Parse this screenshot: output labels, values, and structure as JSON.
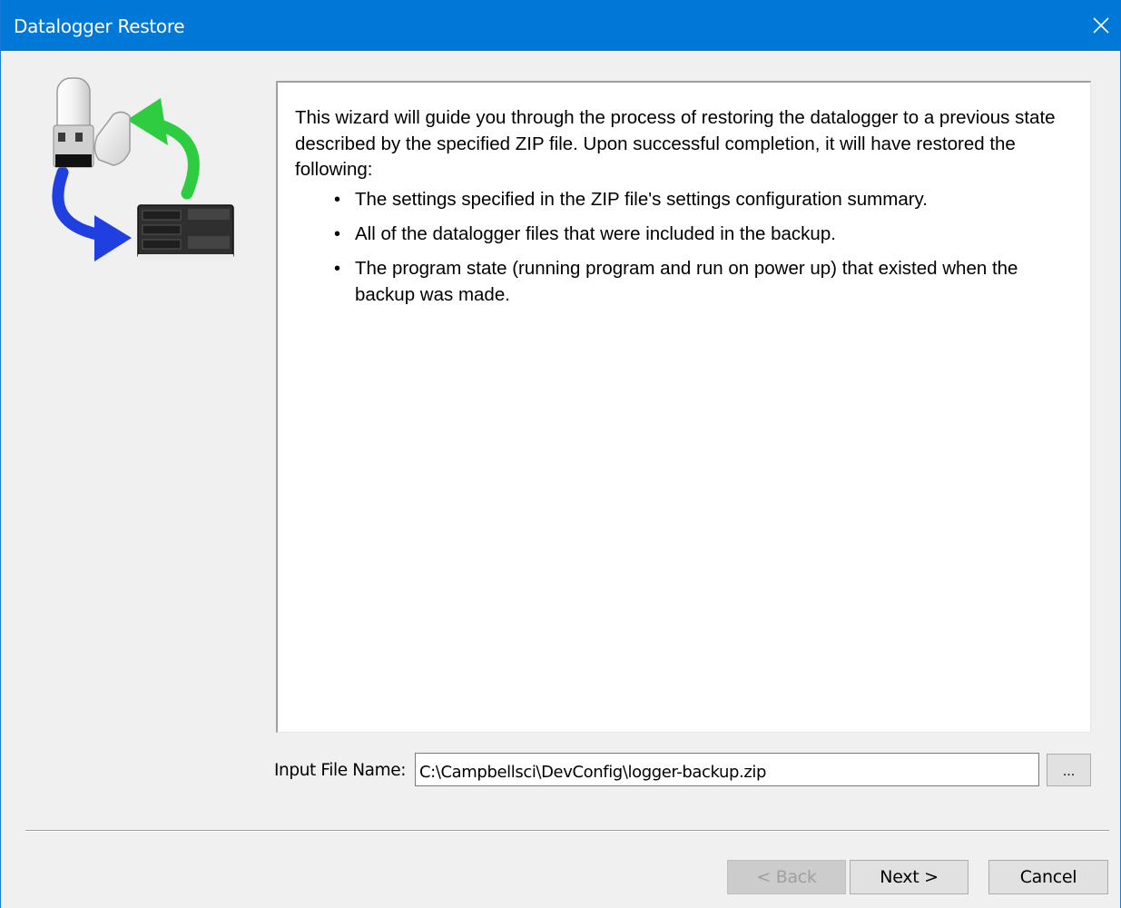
{
  "window": {
    "title": "Datalogger Restore"
  },
  "description": {
    "intro": "This wizard will guide you through the process of restoring the datalogger to a previous state described by the specified ZIP file. Upon successful completion, it will have restored the following:",
    "items": [
      "The settings specified in the ZIP file's settings configuration summary.",
      "All of the datalogger files that were included in the backup.",
      "The program state (running program and run on power up) that existed when the backup was made."
    ]
  },
  "file": {
    "label": "Input File Name:",
    "value": "C:\\Campbellsci\\DevConfig\\logger-backup.zip",
    "browse_label": "..."
  },
  "buttons": {
    "back": "< Back",
    "back_enabled": false,
    "next": "Next >",
    "cancel": "Cancel"
  },
  "icons": {
    "graphic": "usb-restore-datalogger-graphic",
    "close": "close-icon"
  },
  "colors": {
    "titlebar": "#0078d7",
    "arrow_green": "#2ecc40",
    "arrow_blue": "#1f3fe0"
  }
}
